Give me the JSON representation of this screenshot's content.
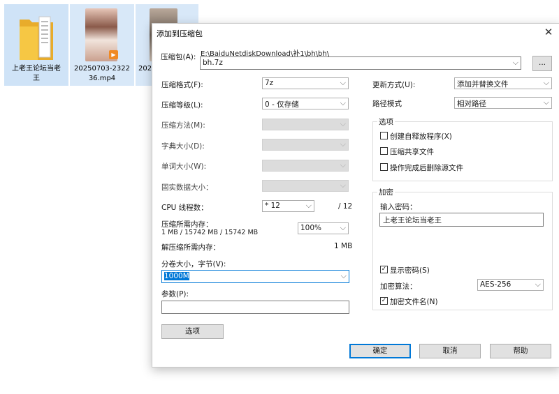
{
  "desktop": {
    "items": [
      {
        "label": "上老王论坛当老王",
        "icon": "folder-icon"
      },
      {
        "label": "20250703-232236.mp4",
        "icon": "video-thumbnail"
      },
      {
        "label": "2025...",
        "icon": "video-thumbnail"
      }
    ],
    "label_lines": [
      "上老王论坛当老",
      "王",
      "20250703-2322",
      "36.mp4",
      "202"
    ]
  },
  "dialog": {
    "title": "添加到压缩包",
    "archive": {
      "label": "压缩包(A):",
      "path": "E:\\BaiduNetdiskDownload\\补1\\bh\\bh\\",
      "filename": "bh.7z",
      "browse_label": "..."
    },
    "left": {
      "format": {
        "label": "压缩格式(F):",
        "value": "7z"
      },
      "level": {
        "label": "压缩等级(L):",
        "value": "0 - 仅存储"
      },
      "method": {
        "label": "压缩方法(M):",
        "value": ""
      },
      "dict": {
        "label": "字典大小(D):",
        "value": ""
      },
      "word": {
        "label": "单词大小(W):",
        "value": ""
      },
      "solid": {
        "label": "固实数据大小：",
        "value": ""
      },
      "cpu": {
        "label": "CPU 线程数：",
        "value": "* 12",
        "total": "/ 12"
      },
      "mem_compress": {
        "label": "压缩所需内存：",
        "detail": "1 MB / 15742 MB / 15742 MB",
        "percent": "100%"
      },
      "mem_decompress": {
        "label": "解压缩所需内存：",
        "value": "1 MB"
      },
      "volume": {
        "label": "分卷大小，字节(V):",
        "value": "1000M"
      },
      "params": {
        "label": "参数(P):",
        "value": ""
      },
      "options_button": "选项"
    },
    "right": {
      "update": {
        "label": "更新方式(U):",
        "value": "添加并替换文件"
      },
      "path_mode": {
        "label": "路径模式",
        "value": "相对路径"
      },
      "options": {
        "title": "选项",
        "sfx": {
          "label": "创建自释放程序(X)",
          "checked": false
        },
        "shared": {
          "label": "压缩共享文件",
          "checked": false
        },
        "delete": {
          "label": "操作完成后删除源文件",
          "checked": false
        }
      },
      "encryption": {
        "title": "加密",
        "password_label": "输入密码：",
        "password_value": "上老王论坛当老王",
        "show_password": {
          "label": "显示密码(S)",
          "checked": true
        },
        "method_label": "加密算法：",
        "method_value": "AES-256",
        "encrypt_names": {
          "label": "加密文件名(N)",
          "checked": true
        }
      }
    },
    "buttons": {
      "ok": "确定",
      "cancel": "取消",
      "help": "帮助"
    },
    "close_glyph": "✕"
  },
  "colors": {
    "accent": "#0078d7",
    "folder": "#f6c744",
    "selection": "#cfe3f7"
  }
}
